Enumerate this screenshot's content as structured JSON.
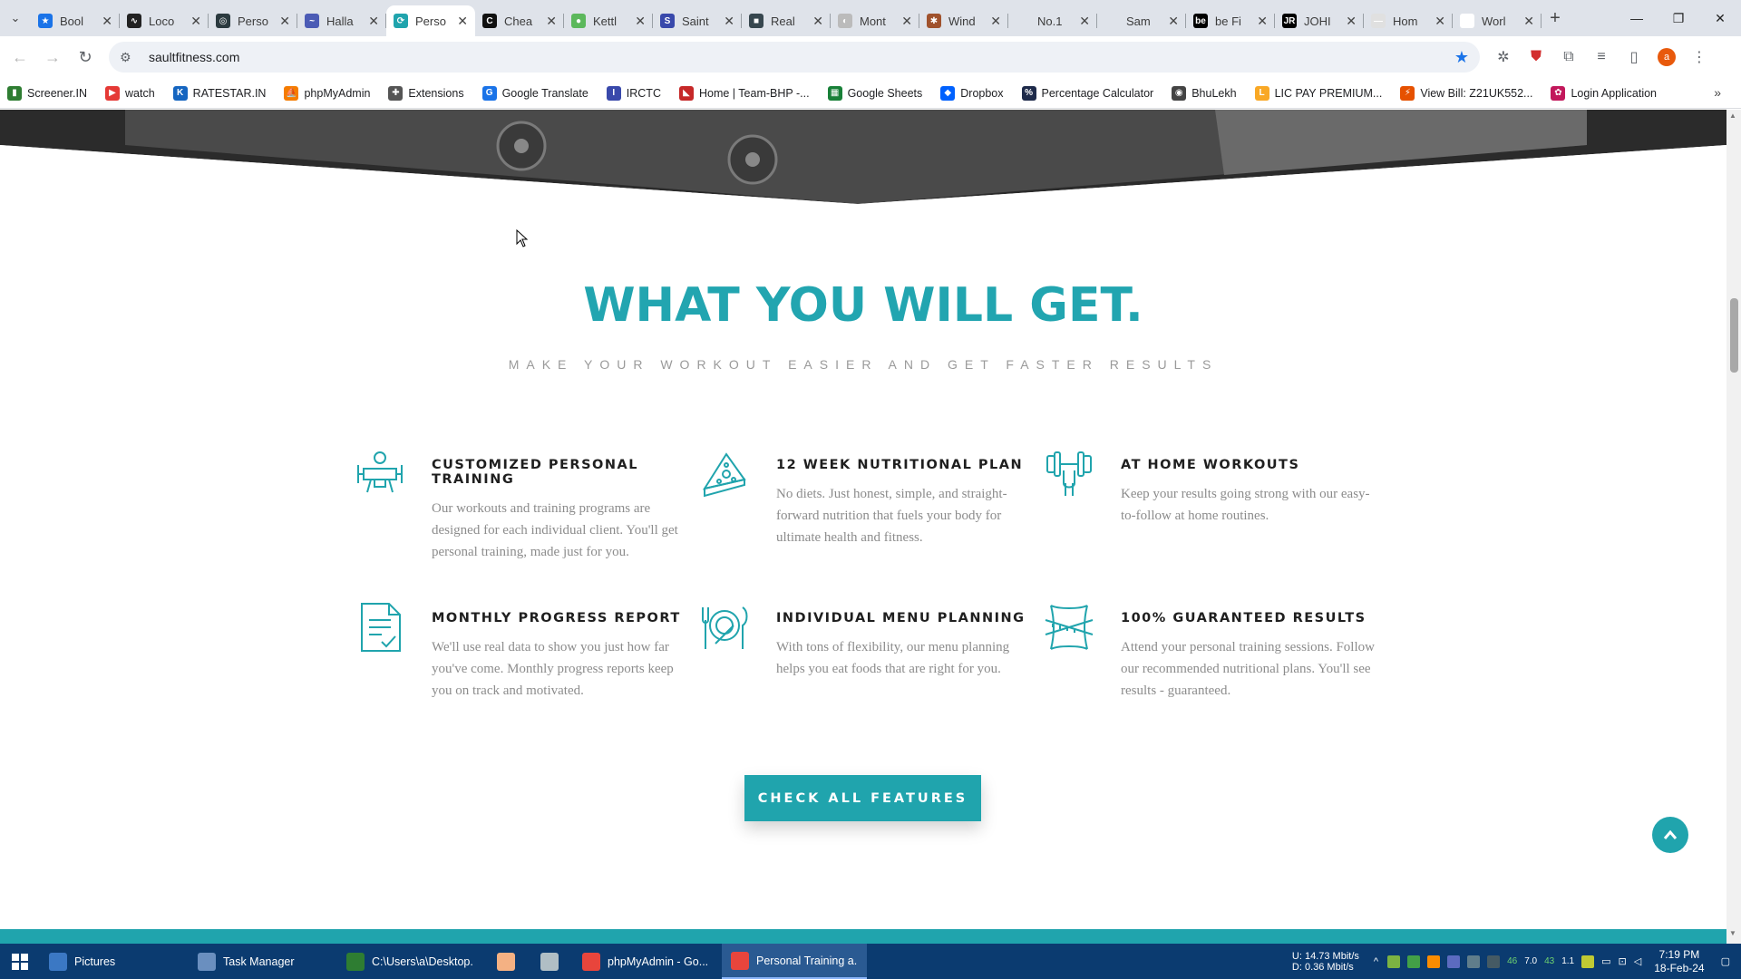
{
  "browser": {
    "tabs": [
      {
        "label": "Bool",
        "color": "#1a73e8",
        "glyph": "★"
      },
      {
        "label": "Loco",
        "color": "#222222",
        "glyph": "∿"
      },
      {
        "label": "Perso",
        "color": "#2b3a3f",
        "glyph": "◎"
      },
      {
        "label": "Halla",
        "color": "#4b5bb5",
        "glyph": "~"
      },
      {
        "label": "Perso",
        "color": "#20a4ad",
        "glyph": "⟳",
        "active": true
      },
      {
        "label": "Chea",
        "color": "#111111",
        "glyph": "C"
      },
      {
        "label": "Kettl",
        "color": "#5cb85c",
        "glyph": "●"
      },
      {
        "label": "Saint",
        "color": "#3949ab",
        "glyph": "S"
      },
      {
        "label": "Real",
        "color": "#37474f",
        "glyph": "■"
      },
      {
        "label": "Mont",
        "color": "#bbbbbb",
        "glyph": "◐"
      },
      {
        "label": "Wind",
        "color": "#a0522d",
        "glyph": "✱"
      },
      {
        "label": "No.1",
        "color": "#dfe3ea",
        "glyph": ""
      },
      {
        "label": "Sam",
        "color": "#dfe3ea",
        "glyph": ""
      },
      {
        "label": "be Fi",
        "color": "#000000",
        "glyph": "be"
      },
      {
        "label": "JOHI",
        "color": "#000000",
        "glyph": "JR"
      },
      {
        "label": "Hom",
        "color": "#e0e0e0",
        "glyph": "—"
      },
      {
        "label": "Worl",
        "color": "#ffffff",
        "glyph": "UP"
      }
    ],
    "url": "saultfitness.com",
    "avatar_letter": "a",
    "bookmarks": [
      {
        "label": "Screener.IN",
        "color": "#2e7d32",
        "glyph": "▮"
      },
      {
        "label": "watch",
        "color": "#e53935",
        "glyph": "▶"
      },
      {
        "label": "RATESTAR.IN",
        "color": "#1565c0",
        "glyph": "K"
      },
      {
        "label": "phpMyAdmin",
        "color": "#f57c00",
        "glyph": "⛵"
      },
      {
        "label": "Extensions",
        "color": "#555555",
        "glyph": "✚"
      },
      {
        "label": "Google Translate",
        "color": "#1a73e8",
        "glyph": "G"
      },
      {
        "label": "IRCTC",
        "color": "#3949ab",
        "glyph": "I"
      },
      {
        "label": "Home | Team-BHP -...",
        "color": "#c62828",
        "glyph": "◣"
      },
      {
        "label": "Google Sheets",
        "color": "#188038",
        "glyph": "▦"
      },
      {
        "label": "Dropbox",
        "color": "#0061fe",
        "glyph": "◆"
      },
      {
        "label": "Percentage Calculator",
        "color": "#1e2a4a",
        "glyph": "%"
      },
      {
        "label": "BhuLekh",
        "color": "#444444",
        "glyph": "◉"
      },
      {
        "label": "LIC PAY PREMIUM...",
        "color": "#f9a825",
        "glyph": "L"
      },
      {
        "label": "View Bill: Z21UK552...",
        "color": "#e65100",
        "glyph": "⚡"
      },
      {
        "label": "Login Application",
        "color": "#c2185b",
        "glyph": "✿"
      }
    ]
  },
  "page": {
    "headline": "WHAT YOU WILL GET.",
    "subline": "MAKE YOUR WORKOUT EASIER AND GET FASTER RESULTS",
    "accent_color": "#20a4ad",
    "features": [
      {
        "title": "CUSTOMIZED PERSONAL TRAINING",
        "desc": "Our workouts and training programs are designed for each individual client. You'll get personal training, made just for you.",
        "icon": "trainer-icon"
      },
      {
        "title": "12 WEEK NUTRITIONAL PLAN",
        "desc": "No diets. Just honest, simple, and straight-forward nutrition that fuels your body for ultimate health and fitness.",
        "icon": "sandwich-icon"
      },
      {
        "title": "AT HOME WORKOUTS",
        "desc": "Keep your results going strong with our easy-to-follow at home routines.",
        "icon": "dumbbell-icon"
      },
      {
        "title": "MONTHLY PROGRESS REPORT",
        "desc": "We'll use real data to show you just how far you've come. Monthly progress reports keep you on track and motivated.",
        "icon": "report-icon"
      },
      {
        "title": "INDIVIDUAL MENU PLANNING",
        "desc": "With tons of flexibility, our menu planning helps you eat foods that are right for you.",
        "icon": "plate-icon"
      },
      {
        "title": "100% GUARANTEED RESULTS",
        "desc": "Attend your personal training sessions. Follow our recommended nutritional plans. You'll see results - guaranteed.",
        "icon": "measuring-tape-icon"
      }
    ],
    "cta_label": "CHECK ALL FEATURES"
  },
  "taskbar": {
    "items": [
      {
        "label": "Pictures",
        "color": "#3b78c4"
      },
      {
        "label": "Task Manager",
        "color": "#6a8fbf"
      },
      {
        "label": "C:\\Users\\a\\Desktop...",
        "color": "#2e7d32"
      },
      {
        "label": "",
        "color": "#f4b183",
        "small": true
      },
      {
        "label": "",
        "color": "#b0bec5",
        "small": true
      },
      {
        "label": "phpMyAdmin - Go...",
        "color": "#e8453c"
      },
      {
        "label": "Personal Training a...",
        "color": "#e8453c",
        "active": true
      }
    ],
    "net_up": "U:   14.73 Mbit/s",
    "net_down": "D:    0.36 Mbit/s",
    "tray_numbers": [
      "46",
      "7.0",
      "43",
      "1.1"
    ],
    "time": "7:19 PM",
    "date": "18-Feb-24"
  }
}
